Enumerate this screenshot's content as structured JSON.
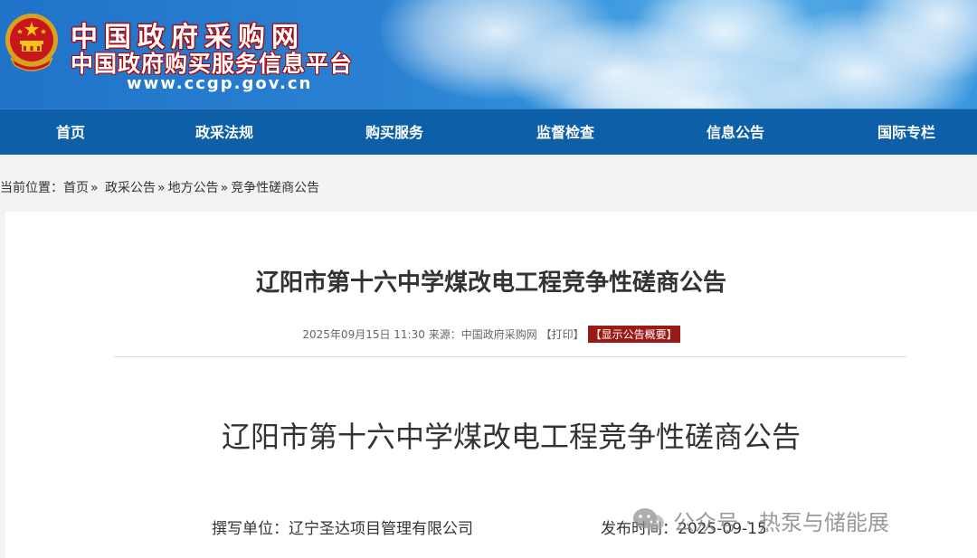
{
  "header": {
    "site_name": "中国政府采购网",
    "site_subtitle": "中国政府购买服务信息平台",
    "site_url": "www.ccgp.gov.cn",
    "emblem_icon": "national-emblem-icon"
  },
  "nav": {
    "items": [
      {
        "label": "首页"
      },
      {
        "label": "政采法规"
      },
      {
        "label": "购买服务"
      },
      {
        "label": "监督检查"
      },
      {
        "label": "信息公告"
      },
      {
        "label": "国际专栏"
      }
    ]
  },
  "breadcrumb": {
    "prefix": "当前位置：",
    "items": [
      "首页",
      "政采公告",
      "地方公告",
      "竞争性磋商公告"
    ],
    "separator": "»"
  },
  "article": {
    "title": "辽阳市第十六中学煤改电工程竞争性磋商公告",
    "meta": {
      "datetime": "2025年09月15日 11:30",
      "source_label": "来源：",
      "source": "中国政府采购网",
      "print_label": "【打印】",
      "summary_label": "【显示公告概要】"
    },
    "doc_title": "辽阳市第十六中学煤改电工程竞争性磋商公告",
    "writer_label": "撰写单位：",
    "writer": "辽宁圣达项目管理有限公司",
    "publish_label": "发布时间：",
    "publish_date": "2025-09-15"
  },
  "watermark": {
    "prefix": "公众号 · ",
    "name": "热泵与储能展",
    "icon": "wechat-icon"
  },
  "colors": {
    "nav_bg": "#0d5fa8",
    "summary_bg": "#9c1a16",
    "banner_blue": "#2a80d2"
  }
}
